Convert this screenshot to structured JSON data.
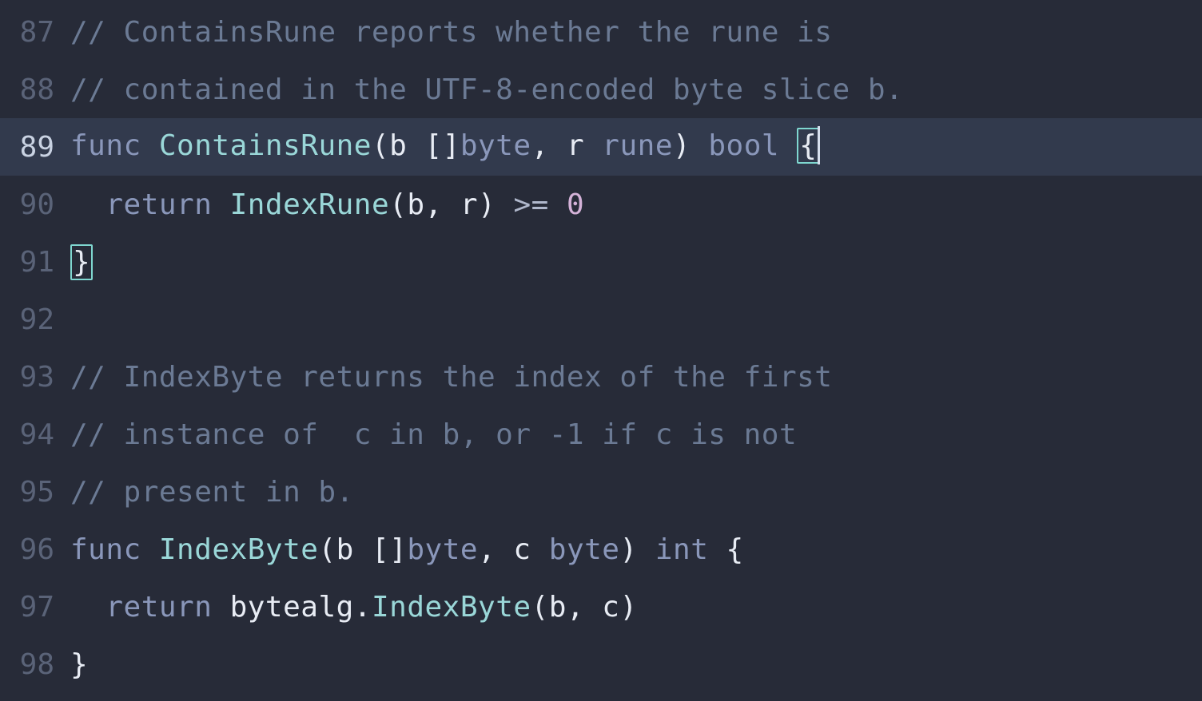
{
  "editor": {
    "current_line_index": 2,
    "lines": [
      {
        "num": "87",
        "tokens": [
          {
            "cls": "tok-comment",
            "t": "// ContainsRune reports whether the rune is"
          }
        ]
      },
      {
        "num": "88",
        "tokens": [
          {
            "cls": "tok-comment",
            "t": "// contained in the UTF-8-encoded byte slice b."
          }
        ]
      },
      {
        "num": "89",
        "tokens": [
          {
            "cls": "tok-keyword",
            "t": "func "
          },
          {
            "cls": "tok-funcdef",
            "t": "ContainsRune"
          },
          {
            "cls": "tok-punct",
            "t": "("
          },
          {
            "cls": "tok-param",
            "t": "b "
          },
          {
            "cls": "tok-punct",
            "t": "[]"
          },
          {
            "cls": "tok-type",
            "t": "byte"
          },
          {
            "cls": "tok-punct",
            "t": ", "
          },
          {
            "cls": "tok-param",
            "t": "r "
          },
          {
            "cls": "tok-type",
            "t": "rune"
          },
          {
            "cls": "tok-punct",
            "t": ") "
          },
          {
            "cls": "tok-type",
            "t": "bool "
          },
          {
            "cls": "tok-punct brace-match",
            "t": "{"
          },
          {
            "cls": "cursor-marker",
            "t": ""
          }
        ]
      },
      {
        "num": "90",
        "tokens": [
          {
            "cls": "tok-ident",
            "t": "  "
          },
          {
            "cls": "tok-keyword",
            "t": "return "
          },
          {
            "cls": "tok-call",
            "t": "IndexRune"
          },
          {
            "cls": "tok-punct",
            "t": "("
          },
          {
            "cls": "tok-ident",
            "t": "b"
          },
          {
            "cls": "tok-punct",
            "t": ", "
          },
          {
            "cls": "tok-ident",
            "t": "r"
          },
          {
            "cls": "tok-punct",
            "t": ") "
          },
          {
            "cls": "tok-op",
            "t": ">= "
          },
          {
            "cls": "tok-num",
            "t": "0"
          }
        ]
      },
      {
        "num": "91",
        "tokens": [
          {
            "cls": "tok-punct brace-match",
            "t": "}"
          }
        ]
      },
      {
        "num": "92",
        "tokens": [
          {
            "cls": "tok-ident",
            "t": ""
          }
        ]
      },
      {
        "num": "93",
        "tokens": [
          {
            "cls": "tok-comment",
            "t": "// IndexByte returns the index of the first"
          }
        ]
      },
      {
        "num": "94",
        "tokens": [
          {
            "cls": "tok-comment",
            "t": "// instance of  c in b, or -1 if c is not"
          }
        ]
      },
      {
        "num": "95",
        "tokens": [
          {
            "cls": "tok-comment",
            "t": "// present in b."
          }
        ]
      },
      {
        "num": "96",
        "tokens": [
          {
            "cls": "tok-keyword",
            "t": "func "
          },
          {
            "cls": "tok-funcdef",
            "t": "IndexByte"
          },
          {
            "cls": "tok-punct",
            "t": "("
          },
          {
            "cls": "tok-param",
            "t": "b "
          },
          {
            "cls": "tok-punct",
            "t": "[]"
          },
          {
            "cls": "tok-type",
            "t": "byte"
          },
          {
            "cls": "tok-punct",
            "t": ", "
          },
          {
            "cls": "tok-param",
            "t": "c "
          },
          {
            "cls": "tok-type",
            "t": "byte"
          },
          {
            "cls": "tok-punct",
            "t": ") "
          },
          {
            "cls": "tok-type",
            "t": "int "
          },
          {
            "cls": "tok-punct",
            "t": "{"
          }
        ]
      },
      {
        "num": "97",
        "tokens": [
          {
            "cls": "tok-ident",
            "t": "  "
          },
          {
            "cls": "tok-keyword",
            "t": "return "
          },
          {
            "cls": "tok-pkg",
            "t": "bytealg"
          },
          {
            "cls": "tok-punct",
            "t": "."
          },
          {
            "cls": "tok-call",
            "t": "IndexByte"
          },
          {
            "cls": "tok-punct",
            "t": "("
          },
          {
            "cls": "tok-ident",
            "t": "b"
          },
          {
            "cls": "tok-punct",
            "t": ", "
          },
          {
            "cls": "tok-ident",
            "t": "c"
          },
          {
            "cls": "tok-punct",
            "t": ")"
          }
        ]
      },
      {
        "num": "98",
        "tokens": [
          {
            "cls": "tok-punct",
            "t": "}"
          }
        ]
      }
    ]
  }
}
